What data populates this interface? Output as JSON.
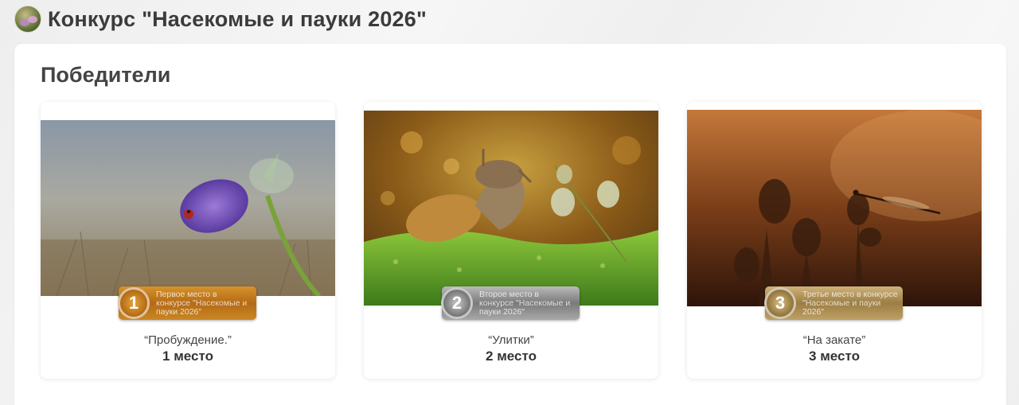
{
  "header": {
    "title": "Конкурс \"Насекомые и пауки 2026\""
  },
  "section": {
    "title": "Победители"
  },
  "winners": [
    {
      "medal_number": "1",
      "badge_text": "Первое место в конкурсе \"Насекомые и пауки 2026\"",
      "photo_name": "“Пробуждение.”",
      "place": "1 место",
      "medal_color": "#c47f1e"
    },
    {
      "medal_number": "2",
      "badge_text": "Второе место в конкурсе \"Насекомые и пауки 2026\"",
      "photo_name": "“Улитки”",
      "place": "2 место",
      "medal_color": "#8d8d8d"
    },
    {
      "medal_number": "3",
      "badge_text": "Третье место в конкурсе \"Насекомые и пауки 2026\"",
      "photo_name": "“На закате”",
      "place": "3 место",
      "medal_color": "#a98b50"
    }
  ]
}
